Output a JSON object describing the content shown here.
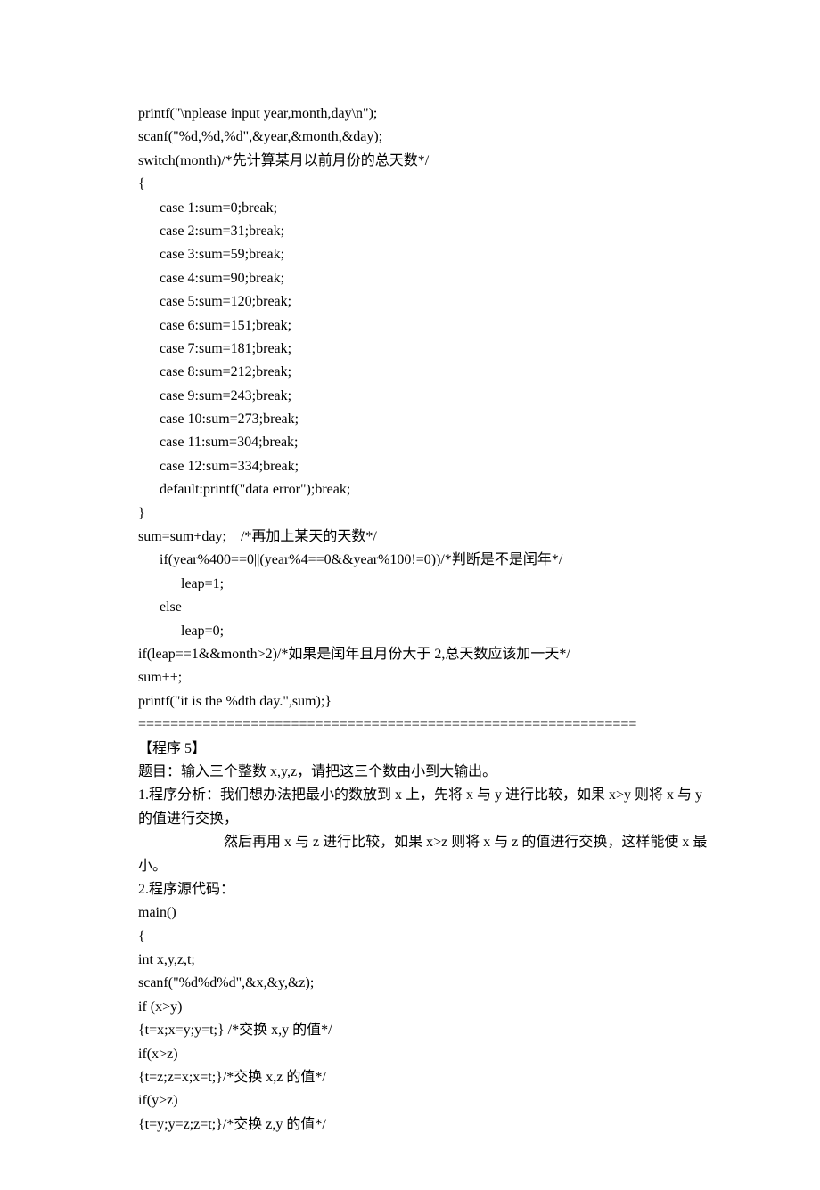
{
  "code": {
    "l1": "printf(\"\\nplease input year,month,day\\n\");",
    "l2": "scanf(\"%d,%d,%d\",&year,&month,&day);",
    "l3": "switch(month)/*先计算某月以前月份的总天数*/",
    "l4": "{",
    "l5": "case 1:sum=0;break;",
    "l6": "case 2:sum=31;break;",
    "l7": "case 3:sum=59;break;",
    "l8": "case 4:sum=90;break;",
    "l9": "case 5:sum=120;break;",
    "l10": "case 6:sum=151;break;",
    "l11": "case 7:sum=181;break;",
    "l12": "case 8:sum=212;break;",
    "l13": "case 9:sum=243;break;",
    "l14": "case 10:sum=273;break;",
    "l15": "case 11:sum=304;break;",
    "l16": "case 12:sum=334;break;",
    "l17": "default:printf(\"data error\");break;",
    "l18": "}",
    "l19": "sum=sum+day;　/*再加上某天的天数*/",
    "l20": "if(year%400==0||(year%4==0&&year%100!=0))/*判断是不是闰年*/",
    "l21": "leap=1;",
    "l22": "else",
    "l23": "leap=0;",
    "l24": "if(leap==1&&month>2)/*如果是闰年且月份大于 2,总天数应该加一天*/",
    "l25": "sum++;",
    "l26": "printf(\"it is the %dth day.\",sum);}",
    "sep": "=============================================================="
  },
  "prog5": {
    "title": "【程序 5】",
    "desc": "题目：输入三个整数 x,y,z，请把这三个数由小到大输出。",
    "analysis1": "1.程序分析：我们想办法把最小的数放到 x 上，先将 x 与 y 进行比较，如果 x>y 则将 x 与 y",
    "analysis2": "的值进行交换，",
    "analysis3": "　　　　　　然后再用 x 与 z 进行比较，如果 x>z 则将 x 与 z 的值进行交换，这样能使 x 最",
    "analysis4": "小。",
    "src": "2.程序源代码：",
    "c1": "main()",
    "c2": "{",
    "c3": "int x,y,z,t;",
    "c4": "scanf(\"%d%d%d\",&x,&y,&z);",
    "c5": "if (x>y)",
    "c6": "{t=x;x=y;y=t;} /*交换 x,y 的值*/",
    "c7": "if(x>z)",
    "c8": "{t=z;z=x;x=t;}/*交换 x,z 的值*/",
    "c9": "if(y>z)",
    "c10": "{t=y;y=z;z=t;}/*交换 z,y 的值*/"
  }
}
